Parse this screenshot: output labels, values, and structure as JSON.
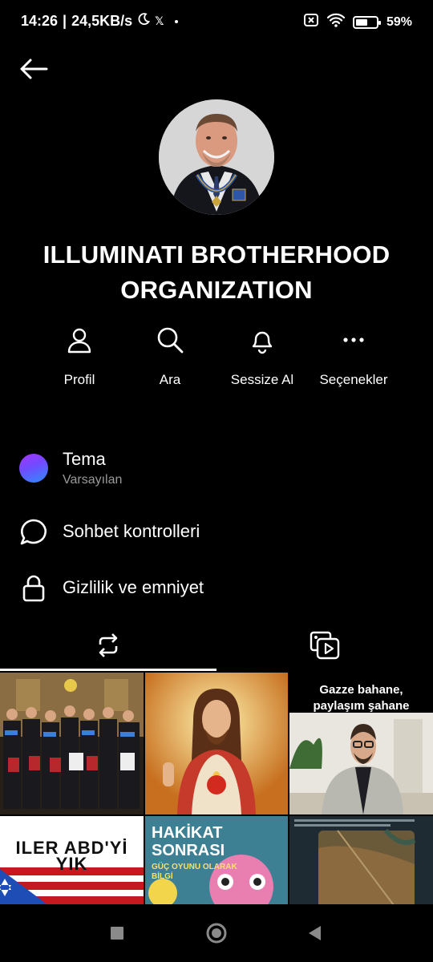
{
  "status_bar": {
    "time": "14:26",
    "speed": "24,5KB/s",
    "moon_icon": "moon-icon",
    "x_label": "𝕏",
    "battery_text": "59%",
    "battery_level": 0.59
  },
  "profile": {
    "name": "ILLUMINATI BROTHERHOOD ORGANIZATION",
    "avatar_icon": "avatar-photo"
  },
  "actions": [
    {
      "label": "Profil",
      "icon": "person-icon"
    },
    {
      "label": "Ara",
      "icon": "search-icon"
    },
    {
      "label": "Sessize Al",
      "icon": "bell-icon"
    },
    {
      "label": "Seçenekler",
      "icon": "more-icon"
    }
  ],
  "menu": {
    "theme": {
      "title": "Tema",
      "subtitle": "Varsayılan"
    },
    "chat_controls": {
      "title": "Sohbet kontrolleri"
    },
    "privacy": {
      "title": "Gizlilik ve emniyet"
    }
  },
  "tabs": [
    {
      "icon": "repost-icon",
      "active": true
    },
    {
      "icon": "media-icon",
      "active": false
    }
  ],
  "grid": {
    "tile3_caption": "Gazze bahane,\npaylaşım şahane",
    "tile4_caption": "ILER ABD'Yİ YIK",
    "tile5_title": "HAKİKAT SONRASI",
    "tile5_sub": "GÜÇ OYUNU OLARAK BİLGİ"
  },
  "colors": {
    "background": "#000000",
    "text": "#ffffff",
    "muted": "#9a9a9a"
  }
}
